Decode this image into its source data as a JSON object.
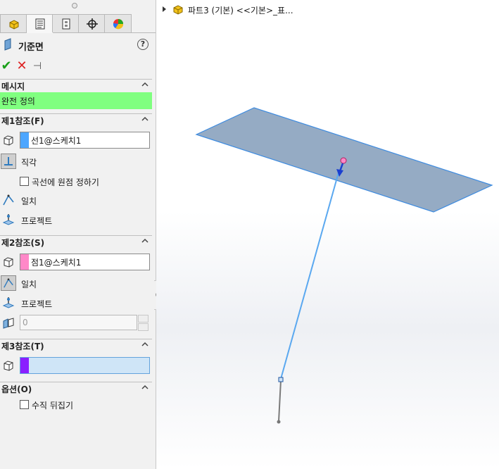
{
  "panel": {
    "title": "기준면",
    "help": "?",
    "actions": {
      "ok": "✔",
      "cancel": "✕",
      "pin": "⊣"
    },
    "tabs": [
      "part-icon",
      "property-manager-icon",
      "config-icon",
      "crosshair-icon",
      "appearance-icon"
    ],
    "message": {
      "header": "메시지",
      "text": "완전 정의",
      "color": "#80ff80"
    },
    "ref1": {
      "header": "제1참조(F)",
      "value": "선1@스케치1",
      "color": "#4da6ff",
      "options": {
        "perpendicular": "직각",
        "set_origin": "곡선에 원점 정하기",
        "coincident": "일치",
        "project": "프로젝트"
      }
    },
    "ref2": {
      "header": "제2참조(S)",
      "value": "점1@스케치1",
      "color": "#ff88c8",
      "options": {
        "coincident": "일치",
        "project": "프로젝트"
      },
      "offset_value": "0"
    },
    "ref3": {
      "header": "제3참조(T)",
      "value": "",
      "color": "#8a1fff"
    },
    "options": {
      "header": "옵션(O)",
      "flip_normal": "수직 뒤집기"
    }
  },
  "viewport": {
    "tree_label": "파트3 (기본) <<기본>_표..."
  },
  "colors": {
    "plane_fill": "#8fa6c1",
    "plane_edge": "#3d8be0",
    "line": "#5aa8f0",
    "accent_green": "#1aa01a",
    "accent_red": "#d22"
  }
}
